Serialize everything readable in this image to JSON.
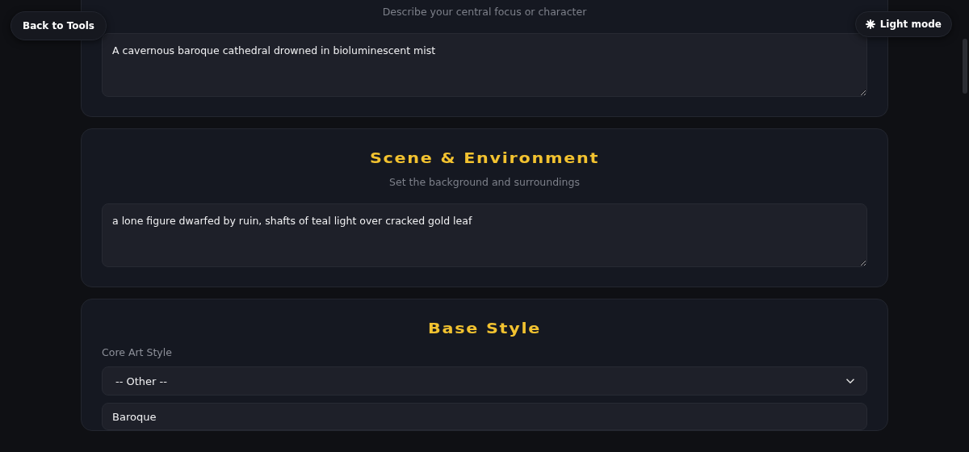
{
  "nav": {
    "back_button": "Back to Tools",
    "theme_button": "Light mode"
  },
  "sections": [
    {
      "kind": "textarea",
      "subtitle": "Describe your central focus or character",
      "value": "A cavernous baroque cathedral drowned in bioluminescent mist"
    },
    {
      "kind": "textarea",
      "title": "Scene & Environment",
      "subtitle": "Set the background and surroundings",
      "value": "a lone figure dwarfed by ruin, shafts of teal light over cracked gold leaf"
    },
    {
      "kind": "style",
      "title": "Base Style",
      "label": "Core Art Style",
      "select_value": "-- Other --",
      "custom_value": "Baroque"
    }
  ]
}
